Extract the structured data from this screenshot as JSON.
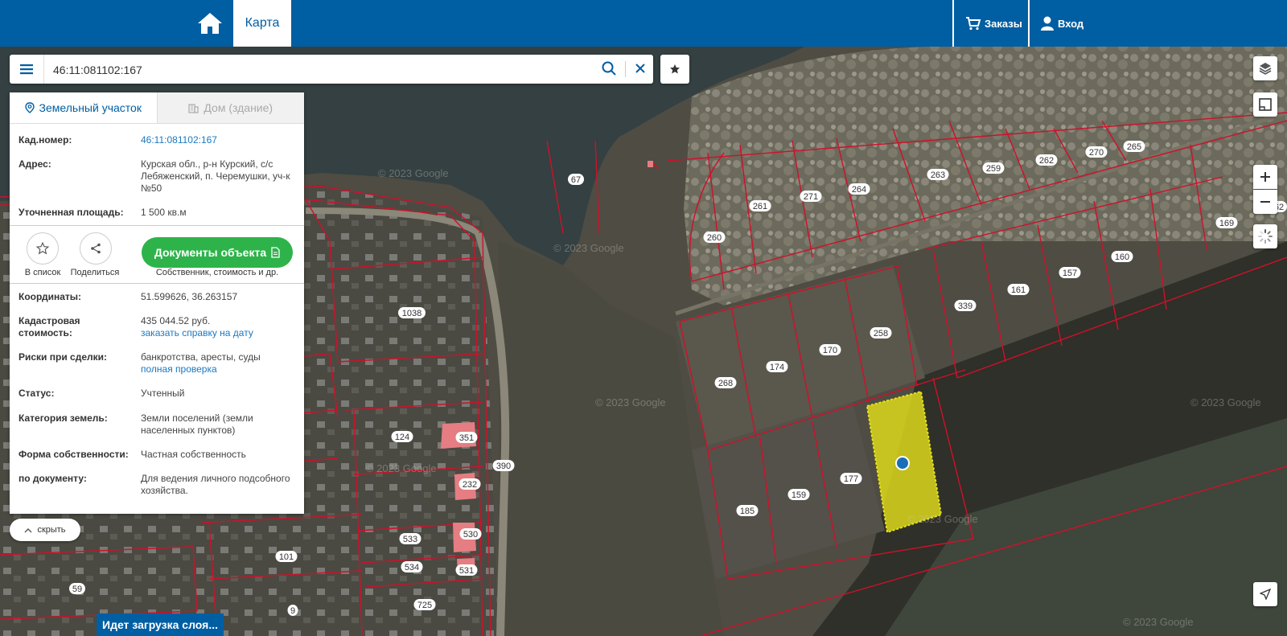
{
  "topbar": {
    "map_tab_label": "Карта",
    "orders_label": "Заказы",
    "login_label": "Вход"
  },
  "search": {
    "value": "46:11:081102:167"
  },
  "panel": {
    "tab_land": "Земельный участок",
    "tab_house": "Дом (здание)",
    "fields": {
      "cad_number_label": "Кад.номер:",
      "cad_number_value": "46:11:081102:167",
      "address_label": "Адрес:",
      "address_value": "Курская обл., р-н Курский, с/с Лебяженский, п. Черемушки, уч-к №50",
      "area_label": "Уточненная площадь:",
      "area_value": "1 500 кв.м",
      "coords_label": "Координаты:",
      "coords_value": "51.599626, 36.263157",
      "cad_cost_label": "Кадастровая стоимость:",
      "cad_cost_value": "435 044.52 руб.",
      "cad_cost_link": "заказать справку на дату",
      "risks_label": "Риски при сделки:",
      "risks_value": "банкротства, аресты, суды",
      "risks_link": "полная проверка",
      "status_label": "Статус:",
      "status_value": "Учтенный",
      "category_label": "Категория земель:",
      "category_value": "Земли поселений (земли населенных пунктов)",
      "ownership_label": "Форма собственности:",
      "ownership_value": "Частная собственность",
      "by_doc_label": "по документу:",
      "by_doc_value": "Для ведения личного подсобного хозяйства."
    },
    "actions": {
      "to_list": "В список",
      "share": "Поделиться",
      "docs_button": "Документы объекта",
      "docs_caption": "Собственник, стоимость и др."
    }
  },
  "hide_label": "скрыть",
  "loading_label": "Идет загрузка слоя...",
  "watermark": "© 2023 Google",
  "parcels": [
    "67",
    "261",
    "271",
    "264",
    "263",
    "259",
    "262",
    "270",
    "265",
    "169",
    "62",
    "260",
    "1038",
    "339",
    "161",
    "157",
    "160",
    "258",
    "170",
    "174",
    "268",
    "124",
    "351",
    "390",
    "232",
    "177",
    "185",
    "159",
    "533",
    "530",
    "534",
    "531",
    "101",
    "59",
    "725",
    "9"
  ],
  "colors": {
    "brand": "#005ea2",
    "green": "#2eb34a",
    "parcel_line": "#d0102a",
    "selected_fill": "#e6e21a",
    "link": "#1a78c2"
  }
}
